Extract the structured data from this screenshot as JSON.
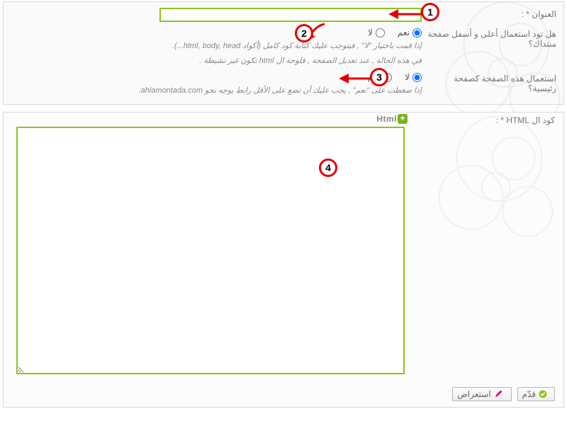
{
  "panel1": {
    "title_label": "العنوان * :",
    "title_value": "",
    "header_footer_label": "هل تود استعمال أعلى و أسفل صفحة منتداك؟",
    "yes": "نعم",
    "no": "لا",
    "hf_help_1": "إذا قمت باختيار \"لا\" , فيتوجب عليك كتابة كود كامل (أكواد html, body, head...).",
    "hf_help_2": "في هذه الحالة , عند تعديل الصفحة , فلوحة ال html تكون غير نشيطة .",
    "homepage_label": "استعمال هذه الصفحة كصفحة رئيسية؟",
    "hp_help": "إذا ضغطت على \"نعم\" , يجب عليك أن تضع على الأقل رابط يوجه نحو ahlamontada.com."
  },
  "panel2": {
    "label": "كود ال HTML * :",
    "badge": "Html",
    "code_value": ""
  },
  "buttons": {
    "done": "قدّم",
    "preview": "استعراض"
  },
  "callouts": {
    "c1": "1",
    "c2": "2",
    "c3": "3",
    "c4": "4"
  }
}
